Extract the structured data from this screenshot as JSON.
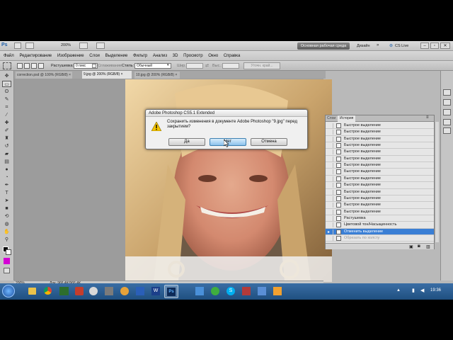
{
  "app": {
    "workspace_button": "Основная рабочая среда",
    "design_label": "Дизайн",
    "cslive": "CS Live",
    "zoom": "200%"
  },
  "menu": [
    "Файл",
    "Редактирование",
    "Изображение",
    "Слои",
    "Выделение",
    "Фильтр",
    "Анализ",
    "3D",
    "Просмотр",
    "Окно",
    "Справка"
  ],
  "options": {
    "feather_label": "Растушевка:",
    "feather_value": "0 пикс",
    "antialias": "Сглаживание",
    "style_label": "Стиль:",
    "style_value": "Обычный",
    "width_label": "Шир.:",
    "height_label": "Выс.:",
    "refine_button": "Уточн. край..."
  },
  "tabs": [
    {
      "label": "correction.psd @ 100% (RGB/8) ×"
    },
    {
      "label": "9.jpg @ 200% (RGB/8) ×"
    },
    {
      "label": "10.jpg @ 200% (RGB/8) ×"
    }
  ],
  "status": {
    "zoom": "200%",
    "doc": "Док: 966,4K/966,4K"
  },
  "history": {
    "tabs": [
      "Слои",
      "История"
    ],
    "items": [
      "Быстрое выделение",
      "Быстрое выделение",
      "Быстрое выделение",
      "Быстрое выделение",
      "Быстрое выделение",
      "Быстрое выделение",
      "Быстрое выделение",
      "Быстрое выделение",
      "Быстрое выделение",
      "Быстрое выделение",
      "Быстрое выделение",
      "Быстрое выделение",
      "Быстрое выделение",
      "Быстрое выделение",
      "Растушевка",
      "Цветовой тон/Насыщенность",
      "Отменить выделение",
      "Обрезать по холсту"
    ],
    "selected_index": 16
  },
  "dialog": {
    "title": "Adobe Photoshop CS5.1 Extended",
    "message": "Сохранить изменения в документе Adobe Photoshop \"9.jpg\" перед закрытием?",
    "yes": "Да",
    "no": "Нет",
    "cancel": "Отмена"
  },
  "taskbar": {
    "clock": "19:36"
  },
  "colors": {
    "selection": "#3a7fd5",
    "accent_fg": "#d400d4",
    "warning": "#f3c300"
  }
}
